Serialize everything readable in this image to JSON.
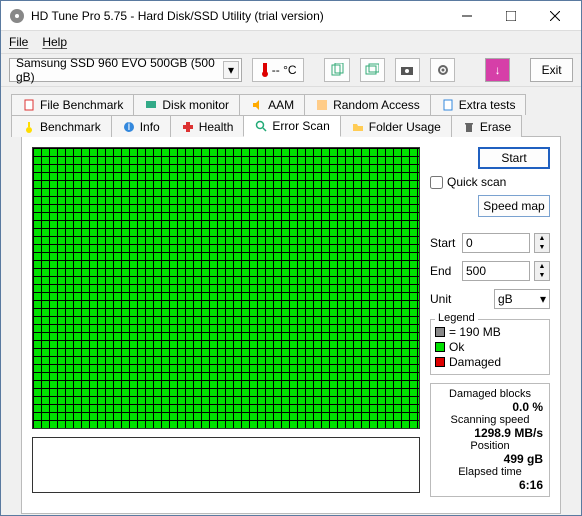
{
  "window": {
    "title": "HD Tune Pro 5.75 - Hard Disk/SSD Utility (trial version)"
  },
  "menu": {
    "file": "File",
    "help": "Help"
  },
  "toolbar": {
    "drive": "Samsung SSD 960 EVO 500GB (500 gB)",
    "temp": "-- °C",
    "exit": "Exit"
  },
  "tabs": {
    "fileBenchmark": "File Benchmark",
    "diskMonitor": "Disk monitor",
    "aam": "AAM",
    "randomAccess": "Random Access",
    "extraTests": "Extra tests",
    "benchmark": "Benchmark",
    "info": "Info",
    "health": "Health",
    "errorScan": "Error Scan",
    "folderUsage": "Folder Usage",
    "erase": "Erase"
  },
  "scan": {
    "startBtn": "Start",
    "quickScan": "Quick scan",
    "speedMap": "Speed map",
    "startLabel": "Start",
    "startVal": "0",
    "endLabel": "End",
    "endVal": "500",
    "unitLabel": "Unit",
    "unitVal": "gB",
    "legend": {
      "title": "Legend",
      "block": "= 190 MB",
      "ok": "Ok",
      "damaged": "Damaged"
    },
    "stats": {
      "damagedLabel": "Damaged blocks",
      "damagedVal": "0.0 %",
      "speedLabel": "Scanning speed",
      "speedVal": "1298.9 MB/s",
      "posLabel": "Position",
      "posVal": "499 gB",
      "elapsedLabel": "Elapsed time",
      "elapsedVal": "6:16"
    }
  }
}
